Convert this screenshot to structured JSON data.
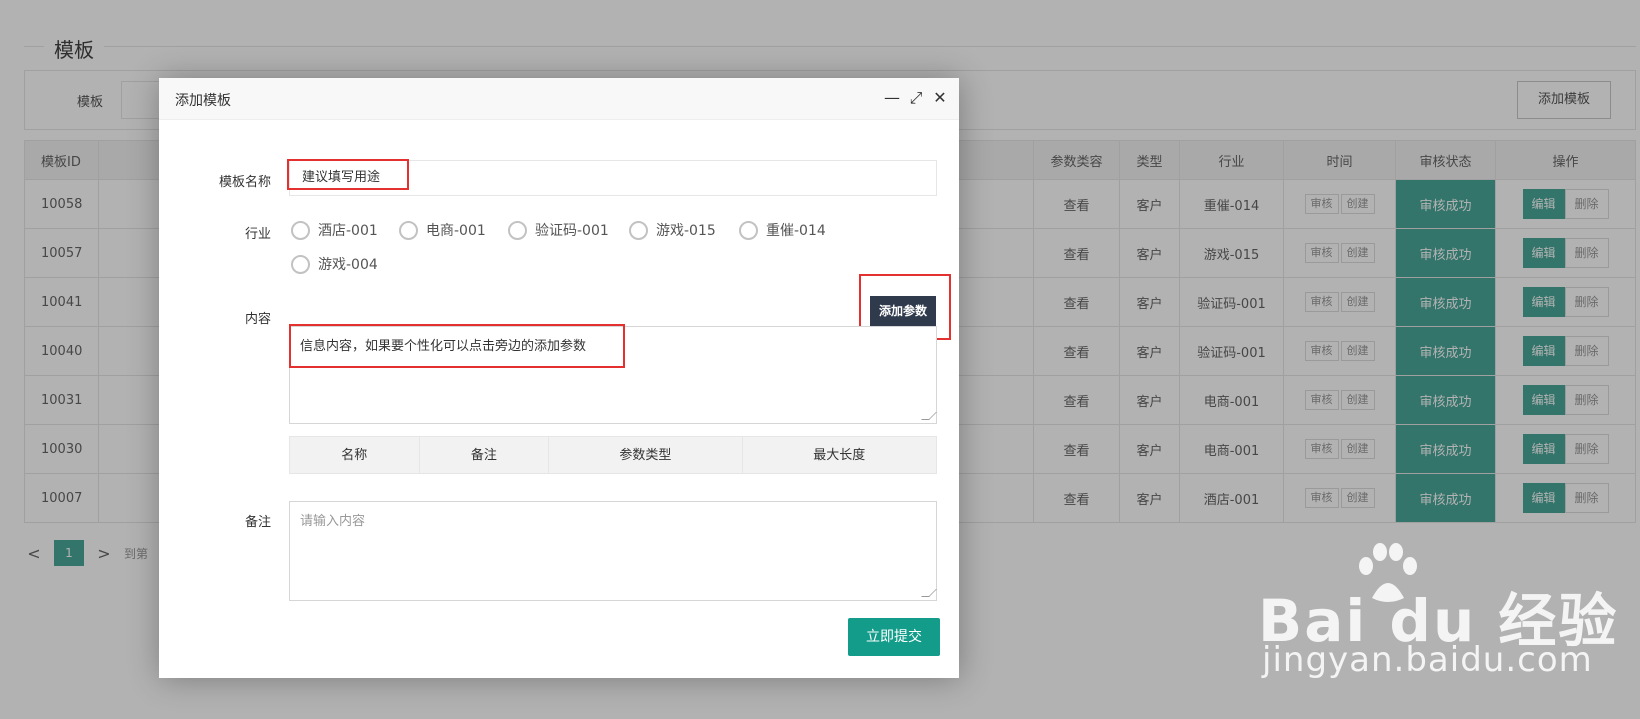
{
  "page": {
    "legend": "模板",
    "search_label": "模板",
    "add_template_label": "添加模板",
    "accent_color": "#4aa89a"
  },
  "table": {
    "headers": {
      "id": "模板ID",
      "param_type": "参数类容",
      "type": "类型",
      "industry": "行业",
      "time": "时间",
      "status": "审核状态",
      "ops": "操作"
    },
    "rows": [
      {
        "id": "10058",
        "param": "查看",
        "type": "客户",
        "industry": "重催-014",
        "t1": "审核",
        "t2": "创建",
        "status": "审核成功",
        "edit": "编辑",
        "del": "删除"
      },
      {
        "id": "10057",
        "param": "查看",
        "type": "客户",
        "industry": "游戏-015",
        "t1": "审核",
        "t2": "创建",
        "status": "审核成功",
        "edit": "编辑",
        "del": "删除"
      },
      {
        "id": "10041",
        "param": "查看",
        "type": "客户",
        "industry": "验证码-001",
        "t1": "审核",
        "t2": "创建",
        "status": "审核成功",
        "edit": "编辑",
        "del": "删除"
      },
      {
        "id": "10040",
        "param": "查看",
        "type": "客户",
        "industry": "验证码-001",
        "t1": "审核",
        "t2": "创建",
        "status": "审核成功",
        "edit": "编辑",
        "del": "删除"
      },
      {
        "id": "10031",
        "param": "查看",
        "type": "客户",
        "industry": "电商-001",
        "t1": "审核",
        "t2": "创建",
        "status": "审核成功",
        "edit": "编辑",
        "del": "删除"
      },
      {
        "id": "10030",
        "param": "查看",
        "type": "客户",
        "industry": "电商-001",
        "t1": "审核",
        "t2": "创建",
        "status": "审核成功",
        "edit": "编辑",
        "del": "删除"
      },
      {
        "id": "10007",
        "param": "查看",
        "type": "客户",
        "industry": "酒店-001",
        "t1": "审核",
        "t2": "创建",
        "status": "审核成功",
        "edit": "编辑",
        "del": "删除"
      }
    ]
  },
  "pager": {
    "prev": "<",
    "current": "1",
    "next": ">",
    "goto_label": "到第"
  },
  "dialog": {
    "title": "添加模板",
    "minimize_icon": "—",
    "maximize_icon": "⤢",
    "close_icon": "✕",
    "name_label": "模板名称",
    "name_value": "建议填写用途",
    "industry_label": "行业",
    "industries": [
      "酒店-001",
      "电商-001",
      "验证码-001",
      "游戏-015",
      "重催-014",
      "游戏-004"
    ],
    "content_label": "内容",
    "add_param_label": "添加参数",
    "content_value": "信息内容，如果要个性化可以点击旁边的添加参数",
    "param_headers": [
      "名称",
      "备注",
      "参数类型",
      "最大长度"
    ],
    "remark_label": "备注",
    "remark_placeholder": "请输入内容",
    "submit_label": "立即提交"
  },
  "watermark": {
    "main": "Bai du 经验",
    "sub": "jingyan.baidu.com"
  }
}
